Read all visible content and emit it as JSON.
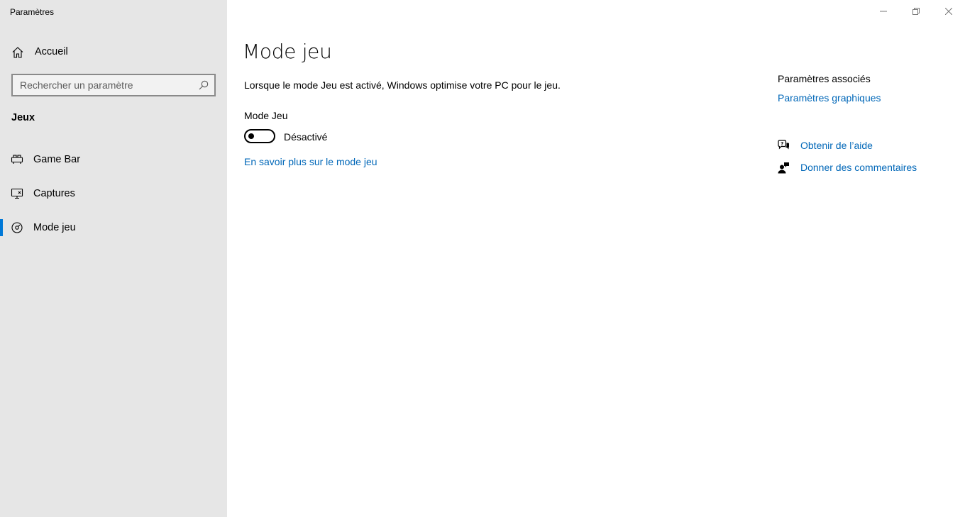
{
  "window": {
    "title": "Paramètres",
    "controls": [
      "minimize-icon",
      "restore-icon",
      "close-icon"
    ]
  },
  "sidebar": {
    "home_label": "Accueil",
    "home_icon": "home-icon",
    "search_placeholder": "Rechercher un paramètre",
    "search_icon": "search-icon",
    "section_title": "Jeux",
    "items": [
      {
        "label": "Game Bar",
        "icon": "game-bar-icon",
        "active": false
      },
      {
        "label": "Captures",
        "icon": "captures-icon",
        "active": false
      },
      {
        "label": "Mode jeu",
        "icon": "game-mode-icon",
        "active": true
      }
    ],
    "accent_color": "#0078d7"
  },
  "main": {
    "title": "Mode jeu",
    "description": "Lorsque le mode Jeu est activé, Windows optimise votre PC pour le jeu.",
    "toggle_label": "Mode Jeu",
    "toggle_state": "Désactivé",
    "toggle_on": false,
    "learn_more_link": "En savoir plus sur le mode jeu"
  },
  "related": {
    "title": "Paramètres associés",
    "graphics_link": "Paramètres graphiques",
    "help_link": "Obtenir de l’aide",
    "help_icon": "help-chat-icon",
    "feedback_link": "Donner des commentaires",
    "feedback_icon": "feedback-icon",
    "link_color": "#0067b8"
  }
}
